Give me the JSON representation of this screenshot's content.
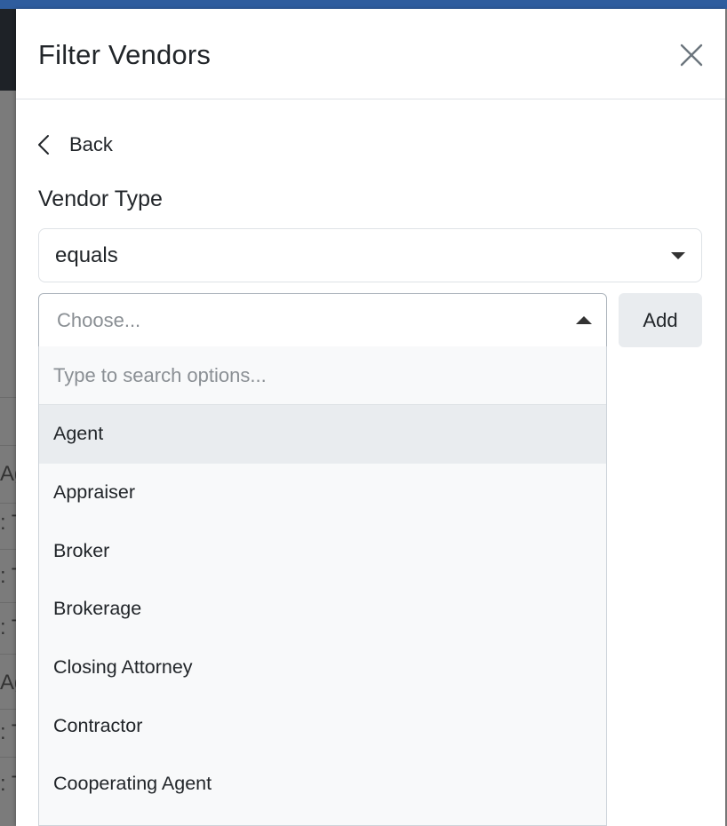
{
  "background": {
    "fragments": [
      {
        "text": "Ag"
      },
      {
        "text": ": T"
      },
      {
        "text": ": T"
      },
      {
        "text": ": T"
      },
      {
        "text": "Ag"
      },
      {
        "text": ": T"
      },
      {
        "text": ": T"
      }
    ]
  },
  "modal": {
    "title": "Filter Vendors",
    "close_icon": "close-icon",
    "back_label": "Back",
    "field_label": "Vendor Type",
    "operator": {
      "selected": "equals"
    },
    "value_select": {
      "placeholder": "Choose...",
      "search_placeholder": "Type to search options...",
      "options": [
        {
          "label": "Agent",
          "highlighted": true
        },
        {
          "label": "Appraiser"
        },
        {
          "label": "Broker"
        },
        {
          "label": "Brokerage"
        },
        {
          "label": "Closing Attorney"
        },
        {
          "label": "Contractor"
        },
        {
          "label": "Cooperating Agent"
        }
      ]
    },
    "add_label": "Add"
  },
  "colors": {
    "accent_bar": "#2f5d9e",
    "highlight": "#e9ecef",
    "dropdown_bg": "#f8f9fa"
  }
}
